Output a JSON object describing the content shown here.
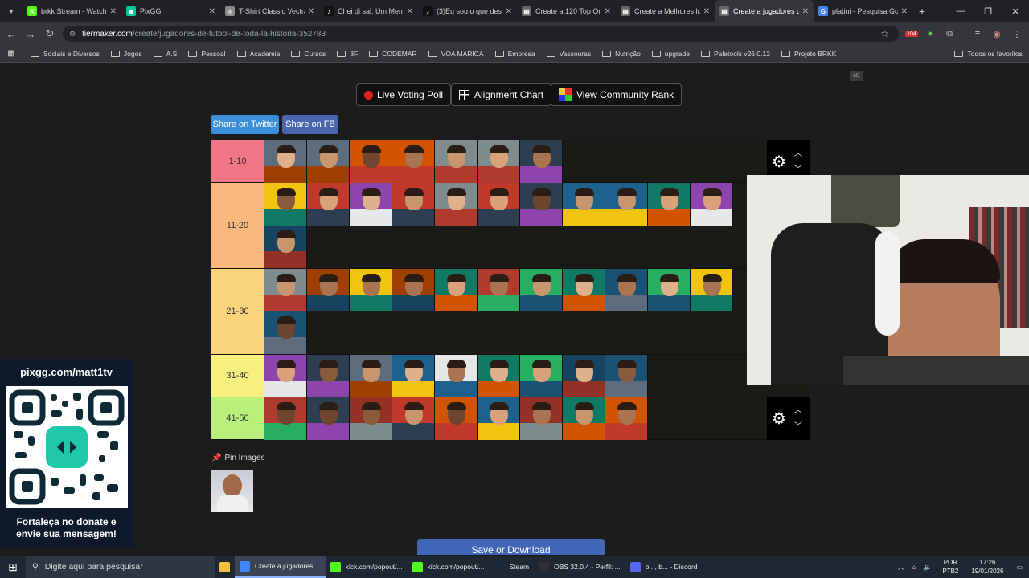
{
  "browser": {
    "tabs": [
      {
        "title": "brkk Stream - Watch",
        "color": "#53fc18",
        "glyph": "K"
      },
      {
        "title": "PixGG",
        "color": "#00c896",
        "glyph": "◆"
      },
      {
        "title": "T-Shirt Classic Vectra",
        "color": "#888888",
        "glyph": "◎"
      },
      {
        "title": "Chei di sal: Um Meme",
        "color": "#111111",
        "glyph": "♪"
      },
      {
        "title": "(3)Eu sou o que desm",
        "color": "#111111",
        "glyph": "♪"
      },
      {
        "title": "Create a 120 Top One",
        "color": "#666666",
        "glyph": "▤"
      },
      {
        "title": "Create a Melhores lu",
        "color": "#666666",
        "glyph": "▤"
      },
      {
        "title": "Create a jugadores de",
        "color": "#666666",
        "glyph": "▤"
      },
      {
        "title": "platini - Pesquisa Go",
        "color": "#4285f4",
        "glyph": "G"
      }
    ],
    "url_host": "tiermaker.com",
    "url_path": "/create/jugadores-de-futbol-de-toda-la-historia-352783",
    "bookmarks": [
      "Sociais e Diversos",
      "Jogos",
      "A.S",
      "Pessoal",
      "Academia",
      "Cursos",
      "3F",
      "CODEMAR",
      "VOA MARICA",
      "Empresa",
      "Vassouras",
      "Nutrição",
      "upgrade",
      "Paletools v26.0.12",
      "Projeto BRKK"
    ],
    "bookmarks_right": "Todos os favoritos",
    "ext_badge": "104"
  },
  "page": {
    "live_poll": "Live Voting Poll",
    "alignment": "Alignment Chart",
    "community": "View Community Rank",
    "share_twitter": "Share on Twitter",
    "share_fb": "Share on FB",
    "ad": "AD",
    "pin_label": "Pin Images",
    "save": "Save or Download",
    "tiers": [
      {
        "label": "1-10",
        "color": "#f07783",
        "count": 7
      },
      {
        "label": "11-20",
        "color": "#f9b87d",
        "count": 12
      },
      {
        "label": "21-30",
        "color": "#fbd37c",
        "count": 12
      },
      {
        "label": "31-40",
        "color": "#f7f07e",
        "count": 9
      },
      {
        "label": "41-50",
        "color": "#b9f07c",
        "count": 9
      }
    ]
  },
  "promo": {
    "title": "pixgg.com/matt1tv",
    "message_line1": "Fortaleça no donate e",
    "message_line2": "envie sua mensagem!"
  },
  "taskbar": {
    "search": "Digite aqui para pesquisar",
    "items": [
      {
        "label": "Create a jugadores ...",
        "color": "#4285f4"
      },
      {
        "label": "kick.com/popout/...",
        "color": "#53fc18"
      },
      {
        "label": "kick.com/popout/...",
        "color": "#53fc18"
      },
      {
        "label": "Steam",
        "color": "#1b2838"
      },
      {
        "label": "OBS 32.0.4 - Perfil: ...",
        "color": "#302e31"
      },
      {
        "label": "b..., b... - Discord",
        "color": "#5865f2"
      }
    ],
    "lang1": "POR",
    "lang2": "PTB2",
    "time": "17:26",
    "date": "19/01/2026"
  }
}
